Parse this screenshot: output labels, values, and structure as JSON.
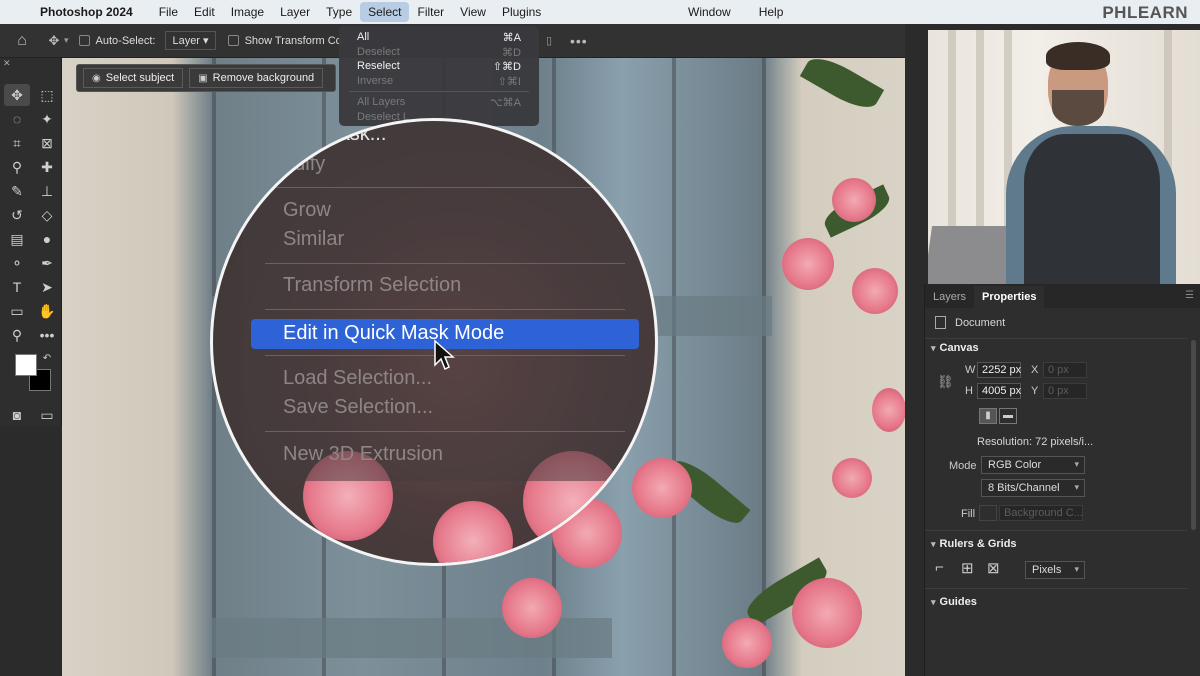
{
  "menubar": {
    "app": "Photoshop 2024",
    "items": [
      "File",
      "Edit",
      "Image",
      "Layer",
      "Type",
      "Select",
      "Filter",
      "View",
      "Plugins"
    ],
    "right_items": [
      "Window",
      "Help"
    ],
    "brand": "PHLEARN"
  },
  "options_bar": {
    "auto_select_label": "Auto-Select:",
    "auto_select_value": "Layer",
    "show_transform_label": "Show Transform Co"
  },
  "context_bar": {
    "select_subject": "Select subject",
    "remove_background": "Remove background"
  },
  "select_menu": {
    "items": [
      {
        "label": "All",
        "shortcut": "⌘A",
        "enabled": true
      },
      {
        "label": "Deselect",
        "shortcut": "⌘D",
        "enabled": false
      },
      {
        "label": "Reselect",
        "shortcut": "⇧⌘D",
        "enabled": true
      },
      {
        "label": "Inverse",
        "shortcut": "⇧⌘I",
        "enabled": false
      }
    ],
    "items2": [
      {
        "label": "All Layers",
        "shortcut": "⌥⌘A",
        "enabled": false
      },
      {
        "label": "Deselect L",
        "shortcut": "",
        "enabled": false
      }
    ]
  },
  "magnifier": {
    "items": {
      "and_mask": "and Mask...",
      "modify": "odify",
      "grow": "Grow",
      "similar": "Similar",
      "transform": "Transform Selection",
      "quick_mask": "Edit in Quick Mask Mode",
      "load": "Load Selection...",
      "save": "Save Selection...",
      "extrusion": "New 3D Extrusion"
    }
  },
  "panel": {
    "tabs": [
      "Layers",
      "Properties"
    ],
    "document_label": "Document",
    "canvas_section": "Canvas",
    "w_label": "W",
    "w_value": "2252 px",
    "h_label": "H",
    "h_value": "4005 px",
    "x_label": "X",
    "x_value": "0 px",
    "y_label": "Y",
    "y_value": "0 px",
    "resolution": "Resolution: 72 pixels/i...",
    "mode_label": "Mode",
    "mode_value": "RGB Color",
    "bits_value": "8 Bits/Channel",
    "fill_label": "Fill",
    "fill_value": "Background C...",
    "rulers_section": "Rulers & Grids",
    "units_value": "Pixels",
    "guides_section": "Guides"
  },
  "colors": {
    "menu_highlight": "#2d63d6",
    "active_menu": "#b8cde3"
  }
}
